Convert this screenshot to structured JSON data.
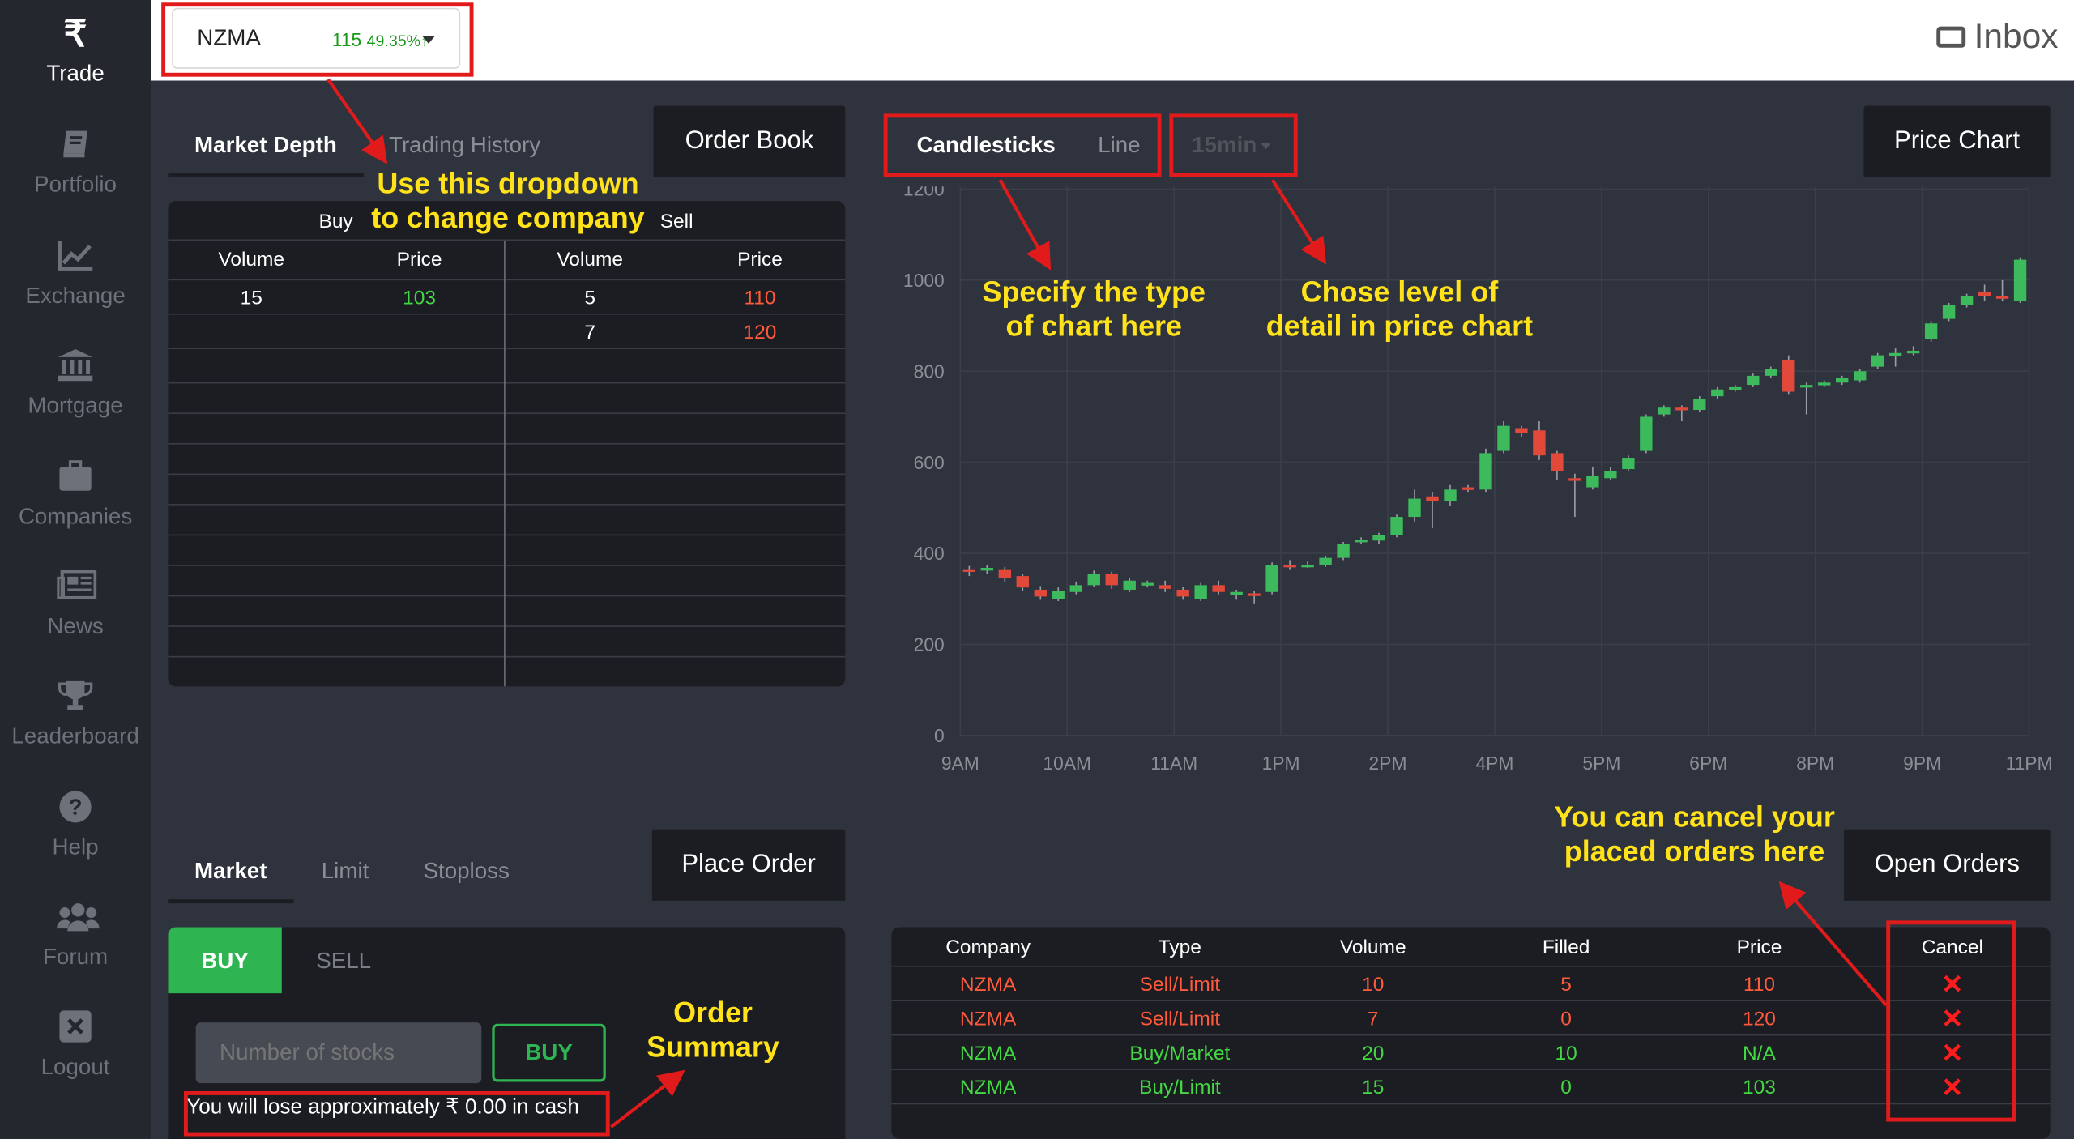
{
  "sidebar": {
    "items": [
      {
        "label": "Trade",
        "icon": "rupee-icon"
      },
      {
        "label": "Portfolio",
        "icon": "book-icon"
      },
      {
        "label": "Exchange",
        "icon": "chart-line-icon"
      },
      {
        "label": "Mortgage",
        "icon": "bank-icon"
      },
      {
        "label": "Companies",
        "icon": "briefcase-icon"
      },
      {
        "label": "News",
        "icon": "newspaper-icon"
      },
      {
        "label": "Leaderboard",
        "icon": "trophy-icon"
      },
      {
        "label": "Help",
        "icon": "question-icon"
      },
      {
        "label": "Forum",
        "icon": "users-icon"
      },
      {
        "label": "Logout",
        "icon": "close-box-icon"
      }
    ]
  },
  "topbar": {
    "company": "NZMA",
    "price": "115",
    "change": "49.35%↑",
    "inbox": "Inbox"
  },
  "order_book": {
    "tabs": [
      "Market Depth",
      "Trading History"
    ],
    "title": "Order Book",
    "buy_label": "Buy",
    "sell_label": "Sell",
    "columns": [
      "Volume",
      "Price",
      "Volume",
      "Price"
    ],
    "buy_rows": [
      {
        "volume": "15",
        "price": "103"
      }
    ],
    "sell_rows": [
      {
        "volume": "5",
        "price": "110"
      },
      {
        "volume": "7",
        "price": "120"
      }
    ]
  },
  "price_chart": {
    "tabs": [
      "Candlesticks",
      "Line"
    ],
    "interval": "15min",
    "title": "Price Chart"
  },
  "chart_data": {
    "type": "candlestick",
    "x_ticks": [
      "9AM",
      "10AM",
      "11AM",
      "1PM",
      "2PM",
      "4PM",
      "5PM",
      "6PM",
      "8PM",
      "9PM",
      "11PM"
    ],
    "y_ticks": [
      0,
      200,
      400,
      600,
      800,
      1000,
      1200
    ],
    "ylim": [
      0,
      1200
    ],
    "candles": [
      {
        "o": 365,
        "c": 360,
        "h": 372,
        "l": 350
      },
      {
        "o": 362,
        "c": 368,
        "h": 375,
        "l": 355
      },
      {
        "o": 365,
        "c": 345,
        "h": 370,
        "l": 338
      },
      {
        "o": 350,
        "c": 325,
        "h": 355,
        "l": 318
      },
      {
        "o": 320,
        "c": 305,
        "h": 328,
        "l": 298
      },
      {
        "o": 300,
        "c": 318,
        "h": 325,
        "l": 295
      },
      {
        "o": 315,
        "c": 330,
        "h": 338,
        "l": 310
      },
      {
        "o": 330,
        "c": 355,
        "h": 362,
        "l": 326
      },
      {
        "o": 355,
        "c": 330,
        "h": 360,
        "l": 322
      },
      {
        "o": 320,
        "c": 340,
        "h": 345,
        "l": 315
      },
      {
        "o": 330,
        "c": 335,
        "h": 340,
        "l": 325
      },
      {
        "o": 330,
        "c": 322,
        "h": 340,
        "l": 315
      },
      {
        "o": 320,
        "c": 305,
        "h": 326,
        "l": 298
      },
      {
        "o": 300,
        "c": 330,
        "h": 335,
        "l": 295
      },
      {
        "o": 330,
        "c": 315,
        "h": 340,
        "l": 310
      },
      {
        "o": 312,
        "c": 315,
        "h": 320,
        "l": 298
      },
      {
        "o": 312,
        "c": 310,
        "h": 318,
        "l": 290
      },
      {
        "o": 315,
        "c": 375,
        "h": 380,
        "l": 310
      },
      {
        "o": 375,
        "c": 370,
        "h": 385,
        "l": 365
      },
      {
        "o": 372,
        "c": 375,
        "h": 382,
        "l": 368
      },
      {
        "o": 375,
        "c": 390,
        "h": 395,
        "l": 370
      },
      {
        "o": 390,
        "c": 420,
        "h": 425,
        "l": 385
      },
      {
        "o": 425,
        "c": 430,
        "h": 435,
        "l": 420
      },
      {
        "o": 428,
        "c": 440,
        "h": 445,
        "l": 420
      },
      {
        "o": 440,
        "c": 480,
        "h": 485,
        "l": 435
      },
      {
        "o": 480,
        "c": 520,
        "h": 540,
        "l": 470
      },
      {
        "o": 525,
        "c": 515,
        "h": 535,
        "l": 455
      },
      {
        "o": 515,
        "c": 540,
        "h": 550,
        "l": 505
      },
      {
        "o": 545,
        "c": 540,
        "h": 550,
        "l": 535
      },
      {
        "o": 540,
        "c": 620,
        "h": 630,
        "l": 535
      },
      {
        "o": 625,
        "c": 680,
        "h": 690,
        "l": 620
      },
      {
        "o": 675,
        "c": 665,
        "h": 680,
        "l": 655
      },
      {
        "o": 670,
        "c": 615,
        "h": 690,
        "l": 605
      },
      {
        "o": 620,
        "c": 580,
        "h": 625,
        "l": 560
      },
      {
        "o": 565,
        "c": 560,
        "h": 575,
        "l": 480
      },
      {
        "o": 545,
        "c": 570,
        "h": 590,
        "l": 540
      },
      {
        "o": 565,
        "c": 580,
        "h": 590,
        "l": 560
      },
      {
        "o": 585,
        "c": 610,
        "h": 615,
        "l": 580
      },
      {
        "o": 625,
        "c": 700,
        "h": 705,
        "l": 620
      },
      {
        "o": 705,
        "c": 720,
        "h": 725,
        "l": 700
      },
      {
        "o": 720,
        "c": 715,
        "h": 725,
        "l": 690
      },
      {
        "o": 715,
        "c": 740,
        "h": 745,
        "l": 710
      },
      {
        "o": 745,
        "c": 760,
        "h": 765,
        "l": 740
      },
      {
        "o": 760,
        "c": 765,
        "h": 770,
        "l": 755
      },
      {
        "o": 770,
        "c": 790,
        "h": 795,
        "l": 765
      },
      {
        "o": 790,
        "c": 805,
        "h": 810,
        "l": 785
      },
      {
        "o": 825,
        "c": 755,
        "h": 835,
        "l": 750
      },
      {
        "o": 770,
        "c": 770,
        "h": 775,
        "l": 705
      },
      {
        "o": 770,
        "c": 775,
        "h": 780,
        "l": 765
      },
      {
        "o": 775,
        "c": 785,
        "h": 790,
        "l": 770
      },
      {
        "o": 780,
        "c": 800,
        "h": 805,
        "l": 775
      },
      {
        "o": 810,
        "c": 835,
        "h": 840,
        "l": 805
      },
      {
        "o": 840,
        "c": 840,
        "h": 850,
        "l": 810
      },
      {
        "o": 840,
        "c": 845,
        "h": 855,
        "l": 835
      },
      {
        "o": 870,
        "c": 905,
        "h": 910,
        "l": 865
      },
      {
        "o": 915,
        "c": 945,
        "h": 950,
        "l": 910
      },
      {
        "o": 945,
        "c": 965,
        "h": 970,
        "l": 940
      },
      {
        "o": 975,
        "c": 965,
        "h": 990,
        "l": 955
      },
      {
        "o": 965,
        "c": 960,
        "h": 1000,
        "l": 955
      },
      {
        "o": 955,
        "c": 1045,
        "h": 1050,
        "l": 950
      }
    ]
  },
  "place_order": {
    "tabs": [
      "Market",
      "Limit",
      "Stoploss"
    ],
    "title": "Place Order",
    "buy_tab": "BUY",
    "sell_tab": "SELL",
    "input_placeholder": "Number of stocks",
    "buy_button": "BUY",
    "summary": "You will lose approximately ₹ 0.00 in cash"
  },
  "open_orders": {
    "title": "Open Orders",
    "columns": [
      "Company",
      "Type",
      "Volume",
      "Filled",
      "Price",
      "Cancel"
    ],
    "rows": [
      {
        "company": "NZMA",
        "type": "Sell/Limit",
        "volume": "10",
        "filled": "5",
        "price": "110",
        "side": "sell"
      },
      {
        "company": "NZMA",
        "type": "Sell/Limit",
        "volume": "7",
        "filled": "0",
        "price": "120",
        "side": "sell"
      },
      {
        "company": "NZMA",
        "type": "Buy/Market",
        "volume": "20",
        "filled": "10",
        "price": "N/A",
        "side": "buy"
      },
      {
        "company": "NZMA",
        "type": "Buy/Limit",
        "volume": "15",
        "filled": "0",
        "price": "103",
        "side": "buy"
      }
    ],
    "cancel_glyph": "✕"
  },
  "annotations": {
    "dropdown": "Use this dropdown\nto change company",
    "chart_type": "Specify the type\nof chart here",
    "detail": "Chose level of\ndetail in price chart",
    "cancel": "You can cancel your\nplaced orders here",
    "summary": "Order\nSummary"
  },
  "colors": {
    "accent_green": "#2eb552",
    "sell_red": "#ff5a3c",
    "buy_green": "#43d843",
    "annotation_yellow": "#ffe21a",
    "annotation_red": "#e11b1b"
  }
}
